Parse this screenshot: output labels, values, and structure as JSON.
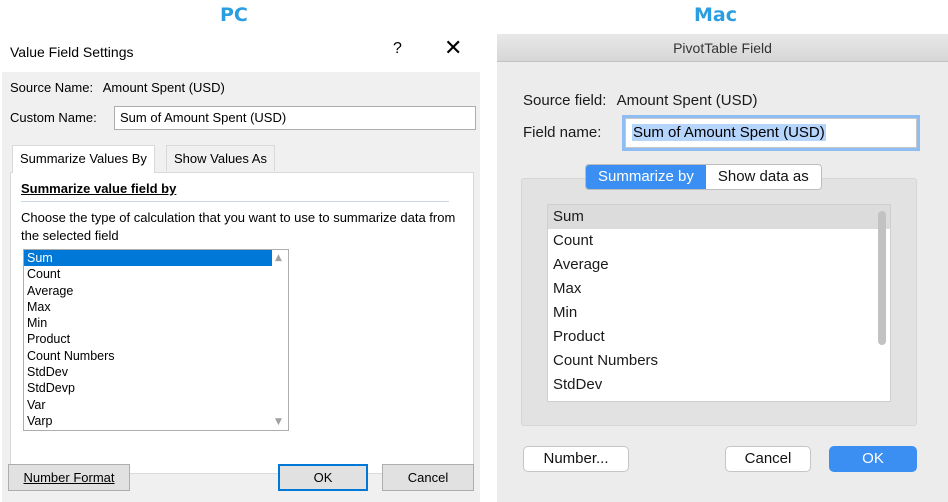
{
  "captions": {
    "pc": "PC",
    "mac": "Mac"
  },
  "colors": {
    "caption": "#2a9ee0",
    "pc_selection": "#0078d7",
    "mac_accent": "#3b8ff3"
  },
  "pc": {
    "title": "Value Field Settings",
    "help": "?",
    "close": "✕",
    "source_name_label": "Source Name:",
    "source_name_value": "Amount Spent (USD)",
    "custom_name_label": "Custom Name:",
    "custom_name_value": "Sum of Amount Spent (USD)",
    "tabs": [
      "Summarize Values By",
      "Show Values As"
    ],
    "section_title": "Summarize value field by",
    "description": "Choose the type of calculation that you want to use to summarize data from the selected field",
    "items": [
      "Sum",
      "Count",
      "Average",
      "Max",
      "Min",
      "Product",
      "Count Numbers",
      "StdDev",
      "StdDevp",
      "Var",
      "Varp"
    ],
    "selected_item": "Sum",
    "buttons": {
      "number_format": "Number Format",
      "ok": "OK",
      "cancel": "Cancel"
    }
  },
  "mac": {
    "title": "PivotTable Field",
    "source_field_label": "Source field:",
    "source_field_value": "Amount Spent (USD)",
    "field_name_label": "Field name:",
    "field_name_value": "Sum of Amount Spent (USD)",
    "segments": [
      "Summarize by",
      "Show data as"
    ],
    "items": [
      "Sum",
      "Count",
      "Average",
      "Max",
      "Min",
      "Product",
      "Count Numbers",
      "StdDev"
    ],
    "selected_item": "Sum",
    "buttons": {
      "number": "Number...",
      "cancel": "Cancel",
      "ok": "OK"
    }
  }
}
